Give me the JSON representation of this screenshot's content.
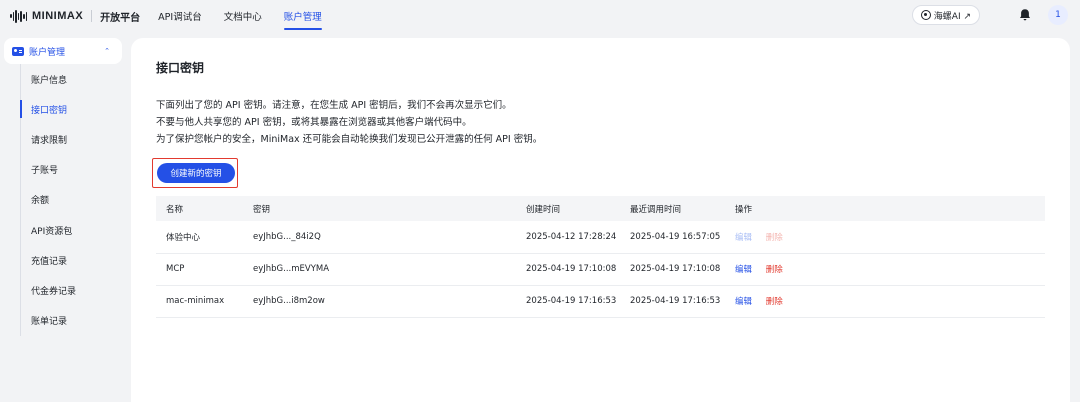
{
  "header": {
    "logo_text": "MINIMAX",
    "brand_sub": "开放平台",
    "nav": [
      {
        "label": "API调试台"
      },
      {
        "label": "文档中心"
      },
      {
        "label": "账户管理"
      }
    ],
    "hailuo_label": "海螺AI ↗",
    "avatar_text": "1"
  },
  "sidebar": {
    "group_label": "账户管理",
    "chevron": "⌃",
    "items": [
      {
        "label": "账户信息"
      },
      {
        "label": "接口密钥"
      },
      {
        "label": "请求限制"
      },
      {
        "label": "子账号"
      },
      {
        "label": "余额"
      },
      {
        "label": "API资源包"
      },
      {
        "label": "充值记录"
      },
      {
        "label": "代金券记录"
      },
      {
        "label": "账单记录"
      }
    ]
  },
  "main": {
    "title": "接口密钥",
    "description": [
      "下面列出了您的 API 密钥。请注意，在您生成 API 密钥后，我们不会再次显示它们。",
      "不要与他人共享您的 API 密钥，或将其暴露在浏览器或其他客户端代码中。",
      "为了保护您帐户的安全，MiniMax 还可能会自动轮换我们发现已公开泄露的任何 API 密钥。"
    ],
    "create_button": "创建新的密钥",
    "table": {
      "headers": [
        "名称",
        "密钥",
        "创建时间",
        "最近调用时间",
        "操作"
      ],
      "rows": [
        {
          "name": "体验中心",
          "key": "eyJhbG..._84i2Q",
          "created": "2025-04-12 17:28:24",
          "last_used": "2025-04-19 16:57:05",
          "edit": "编辑",
          "delete": "删除",
          "disabled": true
        },
        {
          "name": "MCP",
          "key": "eyJhbG...mEVYMA",
          "created": "2025-04-19 17:10:08",
          "last_used": "2025-04-19 17:10:08",
          "edit": "编辑",
          "delete": "删除",
          "disabled": false
        },
        {
          "name": "mac-minimax",
          "key": "eyJhbG...i8m2ow",
          "created": "2025-04-19 17:16:53",
          "last_used": "2025-04-19 17:16:53",
          "edit": "编辑",
          "delete": "删除",
          "disabled": false
        }
      ]
    }
  },
  "colors": {
    "accent": "#2450e6",
    "danger": "#e23a2f",
    "background": "#f2f3f5"
  },
  "icons": {
    "logo": "minimax-waveform-icon",
    "hailuo": "hailuo-logo-icon",
    "notification": "bell-icon",
    "sidebar_group": "id-card-icon"
  }
}
